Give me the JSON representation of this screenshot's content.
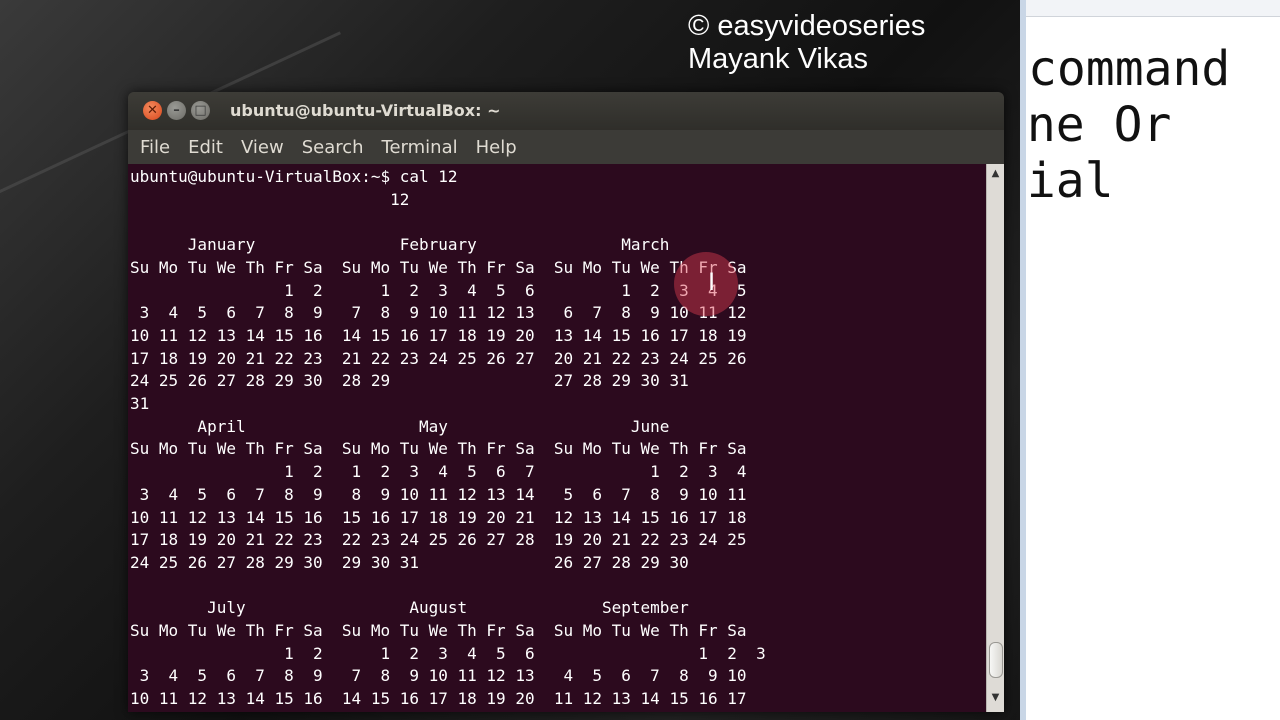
{
  "watermark": {
    "line1": "© easyvideoseries",
    "line2": "Mayank Vikas"
  },
  "document": {
    "line1": "command",
    "line2": "ine Or",
    "line3": "rial"
  },
  "window": {
    "title": "ubuntu@ubuntu-VirtualBox: ~",
    "close_icon": "close-icon",
    "minimize_icon": "minimize-icon",
    "maximize_icon": "maximize-icon"
  },
  "menu": {
    "items": [
      "File",
      "Edit",
      "View",
      "Search",
      "Terminal",
      "Help"
    ]
  },
  "terminal": {
    "prompt": "ubuntu@ubuntu-VirtualBox:~$ ",
    "command": "cal 12",
    "output": "                           12\n\n      January               February               March\nSu Mo Tu We Th Fr Sa  Su Mo Tu We Th Fr Sa  Su Mo Tu We Th Fr Sa\n                1  2      1  2  3  4  5  6         1  2  3  4  5\n 3  4  5  6  7  8  9   7  8  9 10 11 12 13   6  7  8  9 10 11 12\n10 11 12 13 14 15 16  14 15 16 17 18 19 20  13 14 15 16 17 18 19\n17 18 19 20 21 22 23  21 22 23 24 25 26 27  20 21 22 23 24 25 26\n24 25 26 27 28 29 30  28 29                 27 28 29 30 31\n31\n       April                  May                   June\nSu Mo Tu We Th Fr Sa  Su Mo Tu We Th Fr Sa  Su Mo Tu We Th Fr Sa\n                1  2   1  2  3  4  5  6  7            1  2  3  4\n 3  4  5  6  7  8  9   8  9 10 11 12 13 14   5  6  7  8  9 10 11\n10 11 12 13 14 15 16  15 16 17 18 19 20 21  12 13 14 15 16 17 18\n17 18 19 20 21 22 23  22 23 24 25 26 27 28  19 20 21 22 23 24 25\n24 25 26 27 28 29 30  29 30 31              26 27 28 29 30\n\n        July                 August              September\nSu Mo Tu We Th Fr Sa  Su Mo Tu We Th Fr Sa  Su Mo Tu We Th Fr Sa\n                1  2      1  2  3  4  5  6                 1  2  3\n 3  4  5  6  7  8  9   7  8  9 10 11 12 13   4  5  6  7  8  9 10\n10 11 12 13 14 15 16  14 15 16 17 18 19 20  11 12 13 14 15 16 17"
  },
  "scrollbar": {
    "up_icon": "scroll-up-arrow-icon",
    "down_icon": "scroll-down-arrow-icon",
    "position": 0.95
  },
  "colors": {
    "terminal_bg": "#2c0a1e",
    "titlebar": "#3c3b37",
    "close": "#e0562a"
  }
}
